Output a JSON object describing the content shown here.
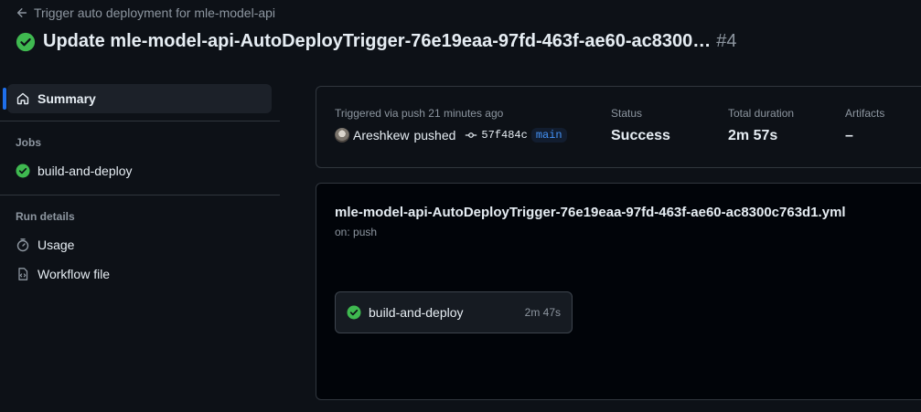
{
  "header": {
    "back_label": "Trigger auto deployment for mle-model-api",
    "title": "Update mle-model-api-AutoDeployTrigger-76e19eaa-97fd-463f-ae60-ac8300…",
    "run_number": "#4"
  },
  "sidebar": {
    "summary_label": "Summary",
    "jobs_heading": "Jobs",
    "jobs": [
      {
        "label": "build-and-deploy",
        "icon": "check-circle-icon"
      }
    ],
    "run_details_heading": "Run details",
    "run_details": [
      {
        "label": "Usage",
        "icon": "stopwatch-icon"
      },
      {
        "label": "Workflow file",
        "icon": "file-code-icon"
      }
    ]
  },
  "summary": {
    "trigger_label": "Triggered via push 21 minutes ago",
    "actor": "Areshkew",
    "action": "pushed",
    "commit_sha": "57f484c",
    "branch": "main",
    "status_label": "Status",
    "status_value": "Success",
    "duration_label": "Total duration",
    "duration_value": "2m 57s",
    "artifacts_label": "Artifacts",
    "artifacts_value": "–"
  },
  "workflow": {
    "name": "mle-model-api-AutoDeployTrigger-76e19eaa-97fd-463f-ae60-ac8300c763d1.yml",
    "trigger": "on: push",
    "job": {
      "name": "build-and-deploy",
      "duration": "2m 47s"
    }
  },
  "colors": {
    "background": "#0d1117",
    "success": "#3fb950",
    "accent": "#1f6feb",
    "muted": "#8d96a0"
  }
}
